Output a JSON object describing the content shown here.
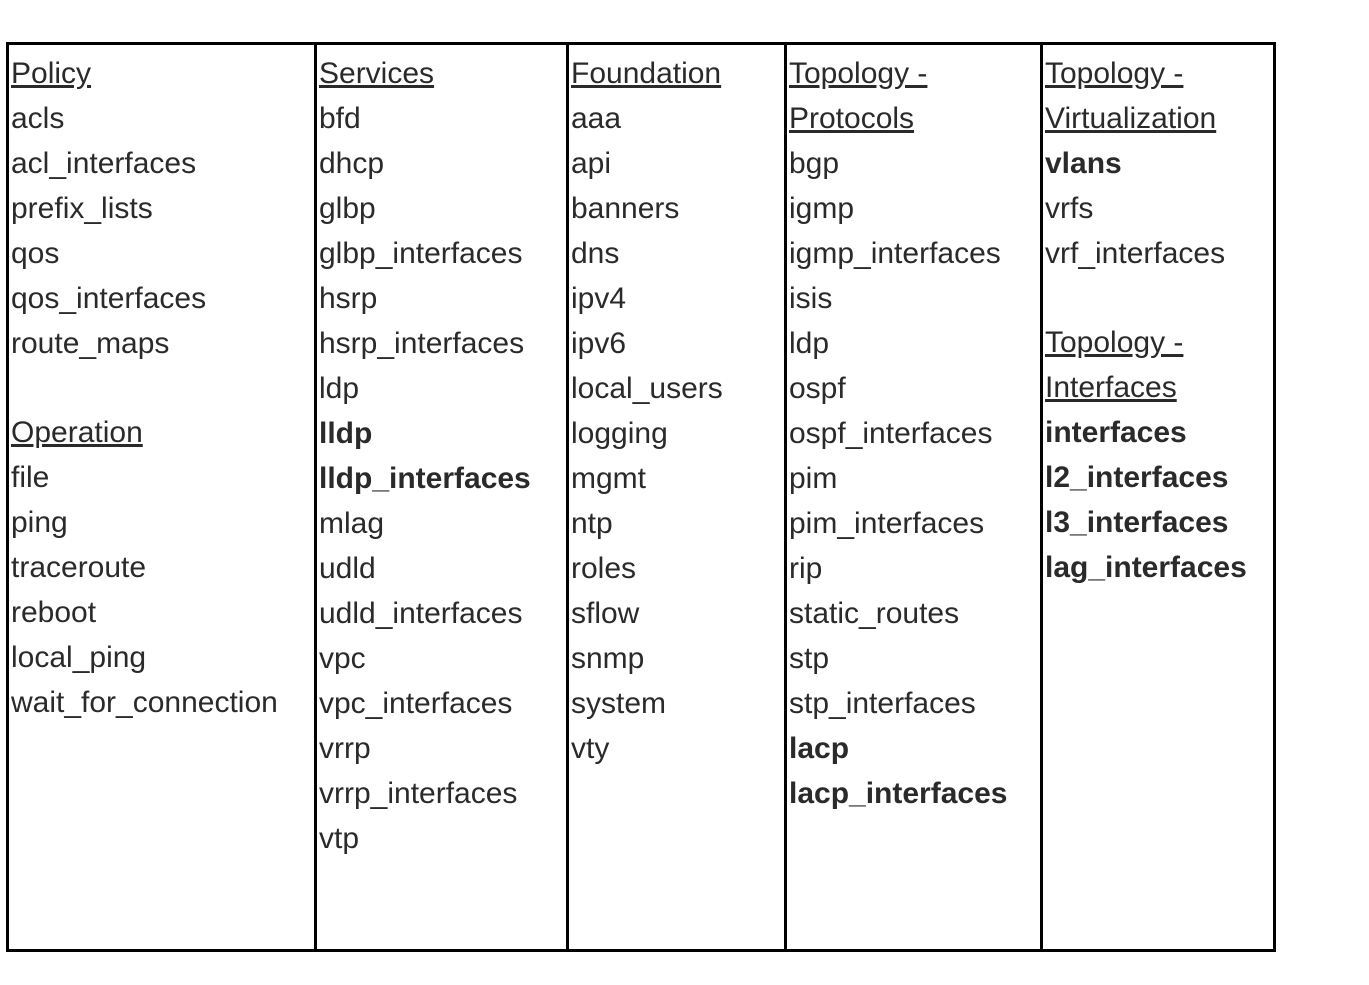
{
  "columns": [
    {
      "sections": [
        {
          "heading": "Policy",
          "items": [
            {
              "text": "acls",
              "bold": false
            },
            {
              "text": "acl_interfaces",
              "bold": false
            },
            {
              "text": "prefix_lists",
              "bold": false
            },
            {
              "text": "qos",
              "bold": false
            },
            {
              "text": "qos_interfaces",
              "bold": false
            },
            {
              "text": "route_maps",
              "bold": false
            }
          ]
        },
        {
          "heading": "Operation",
          "items": [
            {
              "text": "file",
              "bold": false
            },
            {
              "text": "ping",
              "bold": false
            },
            {
              "text": "traceroute",
              "bold": false
            },
            {
              "text": "reboot",
              "bold": false
            },
            {
              "text": "local_ping",
              "bold": false
            },
            {
              "text": "wait_for_connection",
              "bold": false
            }
          ]
        }
      ]
    },
    {
      "sections": [
        {
          "heading": "Services",
          "items": [
            {
              "text": "bfd",
              "bold": false
            },
            {
              "text": "dhcp",
              "bold": false
            },
            {
              "text": "glbp",
              "bold": false
            },
            {
              "text": "glbp_interfaces",
              "bold": false
            },
            {
              "text": "hsrp",
              "bold": false
            },
            {
              "text": "hsrp_interfaces",
              "bold": false
            },
            {
              "text": "ldp",
              "bold": false
            },
            {
              "text": "lldp",
              "bold": true
            },
            {
              "text": "lldp_interfaces",
              "bold": true
            },
            {
              "text": "mlag",
              "bold": false
            },
            {
              "text": "udld",
              "bold": false
            },
            {
              "text": "udld_interfaces",
              "bold": false
            },
            {
              "text": "vpc",
              "bold": false
            },
            {
              "text": "vpc_interfaces",
              "bold": false
            },
            {
              "text": "vrrp",
              "bold": false
            },
            {
              "text": "vrrp_interfaces",
              "bold": false
            },
            {
              "text": "vtp",
              "bold": false
            }
          ]
        }
      ]
    },
    {
      "sections": [
        {
          "heading": "Foundation",
          "items": [
            {
              "text": "aaa",
              "bold": false
            },
            {
              "text": "api",
              "bold": false
            },
            {
              "text": "banners",
              "bold": false
            },
            {
              "text": "dns",
              "bold": false
            },
            {
              "text": "ipv4",
              "bold": false
            },
            {
              "text": "ipv6",
              "bold": false
            },
            {
              "text": "local_users",
              "bold": false
            },
            {
              "text": "logging",
              "bold": false
            },
            {
              "text": "mgmt",
              "bold": false
            },
            {
              "text": "ntp",
              "bold": false
            },
            {
              "text": "roles",
              "bold": false
            },
            {
              "text": "sflow",
              "bold": false
            },
            {
              "text": "snmp",
              "bold": false
            },
            {
              "text": "system",
              "bold": false
            },
            {
              "text": "vty",
              "bold": false
            }
          ]
        }
      ]
    },
    {
      "sections": [
        {
          "heading": "Topology - Protocols",
          "items": [
            {
              "text": "bgp",
              "bold": false
            },
            {
              "text": "igmp",
              "bold": false
            },
            {
              "text": "igmp_interfaces",
              "bold": false
            },
            {
              "text": "isis",
              "bold": false
            },
            {
              "text": "ldp",
              "bold": false
            },
            {
              "text": "ospf",
              "bold": false
            },
            {
              "text": "ospf_interfaces",
              "bold": false
            },
            {
              "text": "pim",
              "bold": false
            },
            {
              "text": "pim_interfaces",
              "bold": false
            },
            {
              "text": "rip",
              "bold": false
            },
            {
              "text": "static_routes",
              "bold": false
            },
            {
              "text": "stp",
              "bold": false
            },
            {
              "text": "stp_interfaces",
              "bold": false
            },
            {
              "text": "lacp",
              "bold": true
            },
            {
              "text": "lacp_interfaces",
              "bold": true
            }
          ]
        }
      ]
    },
    {
      "sections": [
        {
          "heading": "Topology - Virtualization",
          "items": [
            {
              "text": "vlans",
              "bold": true
            },
            {
              "text": "vrfs",
              "bold": false
            },
            {
              "text": "vrf_interfaces",
              "bold": false
            }
          ]
        },
        {
          "heading": "Topology - Interfaces",
          "items": [
            {
              "text": "interfaces",
              "bold": true
            },
            {
              "text": "l2_interfaces",
              "bold": true
            },
            {
              "text": "l3_interfaces",
              "bold": true
            },
            {
              "text": "lag_interfaces",
              "bold": true
            }
          ]
        }
      ]
    }
  ]
}
